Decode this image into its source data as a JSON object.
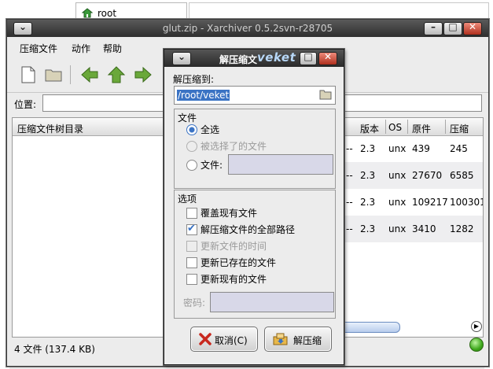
{
  "background": {
    "file_panel_item": "root"
  },
  "window": {
    "title": "glut.zip - Xarchiver 0.5.2svn-r28705",
    "menu": [
      "压缩文件",
      "动作",
      "帮助"
    ],
    "location_label": "位置:",
    "location_value": "",
    "tree_header": "压缩文件树目录",
    "columns": [
      "版本",
      "OS",
      "原件",
      "压缩"
    ],
    "rows": [
      {
        "dash": "--",
        "version": "2.3",
        "os": "unx",
        "original": "439",
        "compressed": "245"
      },
      {
        "dash": "--",
        "version": "2.3",
        "os": "unx",
        "original": "27670",
        "compressed": "6585"
      },
      {
        "dash": "--",
        "version": "2.3",
        "os": "unx",
        "original": "109217",
        "compressed": "100301"
      },
      {
        "dash": "--",
        "version": "2.3",
        "os": "unx",
        "original": "3410",
        "compressed": "1282"
      }
    ],
    "status": "4 文件   (137.4 KB)",
    "colors": {
      "title_bg": "#3a3a3a",
      "accent": "#3a73c4",
      "status_led": "#3ea81c"
    }
  },
  "dialog": {
    "title": "解压缩文",
    "title_overlay": "veket",
    "extract_to_label": "解压缩到:",
    "path": "/root/veket",
    "files_group": "文件",
    "opt_all": "全选",
    "opt_selected": "被选择了的文件",
    "opt_files": "文件:",
    "options_group": "选项",
    "cb_overwrite": "覆盖现有文件",
    "cb_fullpath": "解压缩文件的全部路径",
    "cb_touch": "更新文件的时间",
    "cb_fresh": "更新已存在的文件",
    "cb_update": "更新现有的文件",
    "password_label": "密码:",
    "cancel": "取消(C)",
    "extract": "解压缩"
  }
}
